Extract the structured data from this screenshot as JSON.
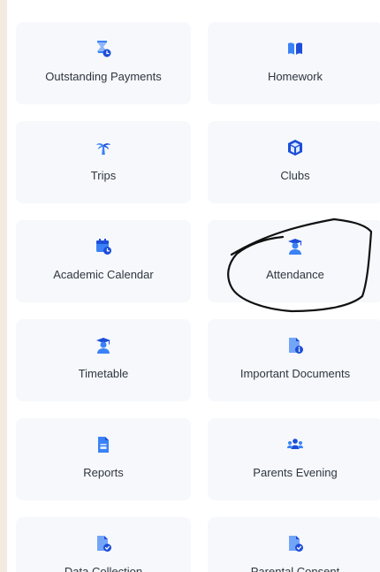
{
  "tiles": [
    {
      "label": "Outstanding Payments",
      "icon": "hourglass-clock-icon"
    },
    {
      "label": "Homework",
      "icon": "book-open-icon"
    },
    {
      "label": "Trips",
      "icon": "palm-tree-icon"
    },
    {
      "label": "Clubs",
      "icon": "cube-icon"
    },
    {
      "label": "Academic Calendar",
      "icon": "calendar-clock-icon"
    },
    {
      "label": "Attendance",
      "icon": "graduate-user-icon"
    },
    {
      "label": "Timetable",
      "icon": "graduate-user-icon"
    },
    {
      "label": "Important Documents",
      "icon": "document-info-icon"
    },
    {
      "label": "Reports",
      "icon": "report-document-icon"
    },
    {
      "label": "Parents Evening",
      "icon": "users-group-icon"
    },
    {
      "label": "Data Collection",
      "icon": "document-check-icon"
    },
    {
      "label": "Parental Consent",
      "icon": "document-check-icon"
    }
  ],
  "colors": {
    "accent": "#3b82f6",
    "tile_bg": "#f6f8fb",
    "page_bg": "#f3ebe0"
  }
}
